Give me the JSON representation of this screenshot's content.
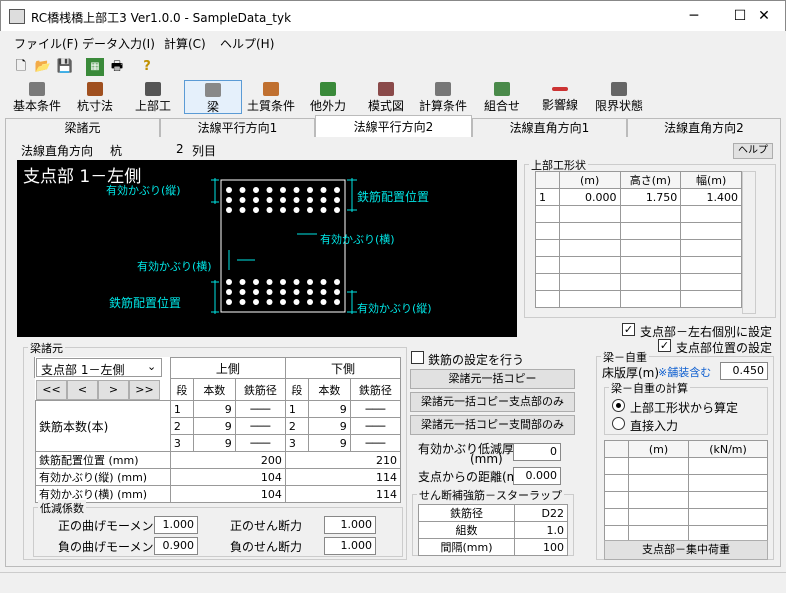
{
  "window": {
    "title": "RC橋桟橋上部工3 Ver1.0.0 - SampleData_tyk",
    "min": "─",
    "max": "☐",
    "close": "✕"
  },
  "menu": [
    "ファイル(F)",
    "データ入力(I)",
    "計算(C)",
    "ヘルプ(H)"
  ],
  "toolbar_icons": [
    "new-file",
    "open-folder",
    "save",
    "calc",
    "print",
    "help"
  ],
  "toolbar_icon_glyphs": [
    "🗋",
    "📂",
    "💾",
    "▦",
    "🖶",
    "?"
  ],
  "toolbar": [
    {
      "label": "基本条件",
      "color": "#7a7a7a"
    },
    {
      "label": "杭寸法",
      "color": "#a05020"
    },
    {
      "label": "上部工",
      "color": "#555555"
    },
    {
      "label": "梁",
      "color": "#888888"
    },
    {
      "label": "土質条件",
      "color": "#c07030"
    },
    {
      "label": "他外力",
      "color": "#3a8a3a"
    },
    {
      "label": "模式図",
      "color": "#8a4a4a"
    },
    {
      "label": "計算条件",
      "color": "#777777"
    },
    {
      "label": "組合せ",
      "color": "#4a8a4a"
    },
    {
      "label": "影響線",
      "color": "#cc3333"
    },
    {
      "label": "限界状態",
      "color": "#666666"
    }
  ],
  "tabs": [
    "梁諸元",
    "法線平行方向1",
    "法線平行方向2",
    "法線直角方向1",
    "法線直角方向2"
  ],
  "header": {
    "direction": "法線直角方向",
    "kind": "杭",
    "col_num": "2",
    "col_label": "列目",
    "help": "ヘルプ"
  },
  "diagram": {
    "title": "支点部 1－左側",
    "labels": {
      "cover_v_top": "有効かぶり(縦)",
      "rebar_pos_top": "鉄筋配置位置",
      "cover_h_right": "有効かぶり(横)",
      "cover_h_left": "有効かぶり(横)",
      "rebar_pos_bottom": "鉄筋配置位置",
      "cover_v_bottom": "有効かぶり(縦)"
    },
    "rebar_count_per_row": 9,
    "rebar_rows": 3
  },
  "upper_shape": {
    "title": "上部工形状",
    "headers": [
      "",
      "(m)",
      "高さ(m)",
      "幅(m)"
    ],
    "rows": [
      [
        "1",
        "0.000",
        "1.750",
        "1.400"
      ]
    ]
  },
  "checks": {
    "lr_individual": "支点部－左右個別に設定",
    "pos_setting": "支点部位置の設定",
    "rebar_setting": "鉄筋の設定を行う"
  },
  "beam": {
    "title": "梁諸元",
    "select": "支点部 1－左側",
    "nav": [
      "<<",
      "<",
      ">",
      ">>"
    ],
    "upper": "上側",
    "lower": "下側",
    "sub_headers": [
      "段",
      "本数",
      "鉄筋径"
    ],
    "row_label": "鉄筋本数(本)",
    "rows": [
      {
        "dan": "1",
        "count": "9",
        "dia": "───",
        "dan2": "1",
        "count2": "9",
        "dia2": "───"
      },
      {
        "dan": "2",
        "count": "9",
        "dia": "───",
        "dan2": "2",
        "count2": "9",
        "dia2": "───"
      },
      {
        "dan": "3",
        "count": "9",
        "dia": "───",
        "dan2": "3",
        "count2": "9",
        "dia2": "───"
      }
    ],
    "params": [
      {
        "label": "鉄筋配置位置 (mm)",
        "upper": "200",
        "lower": "210"
      },
      {
        "label": "有効かぶり(縦) (mm)",
        "upper": "104",
        "lower": "114"
      },
      {
        "label": "有効かぶり(横) (mm)",
        "upper": "104",
        "lower": "114"
      }
    ]
  },
  "reduction": {
    "title": "低減係数",
    "pos_moment_label": "正の曲げモーメント",
    "pos_moment": "1.000",
    "pos_shear_label": "正のせん断力",
    "pos_shear": "1.000",
    "neg_moment_label": "負の曲げモーメント",
    "neg_moment": "0.900",
    "neg_shear_label": "負のせん断力",
    "neg_shear": "1.000"
  },
  "copy_buttons": [
    "梁諸元一括コピー",
    "梁諸元一括コピー支点部のみ",
    "梁諸元一括コピー支間部のみ"
  ],
  "cover_reduction": {
    "label": "有効かぶり低減厚",
    "unit": "(mm)",
    "value": "0"
  },
  "support_distance": {
    "label": "支点からの距離(m)",
    "value": "0.000"
  },
  "stirrup": {
    "title": "せん断補強筋－スターラップ",
    "rows": [
      [
        "鉄筋径",
        "D22"
      ],
      [
        "組数",
        "1.0"
      ],
      [
        "間隔(mm)",
        "100"
      ]
    ]
  },
  "self_weight": {
    "title": "梁－自重",
    "slab_label": "床版厚(m)",
    "slab_note": "※舗装含む",
    "slab_value": "0.450",
    "calc_title": "梁－自重の計算",
    "radio_shape": "上部工形状から算定",
    "radio_direct": "直接入力",
    "table_headers": [
      "",
      "(m)",
      "(kN/m)"
    ],
    "button": "支点部－集中荷重"
  }
}
